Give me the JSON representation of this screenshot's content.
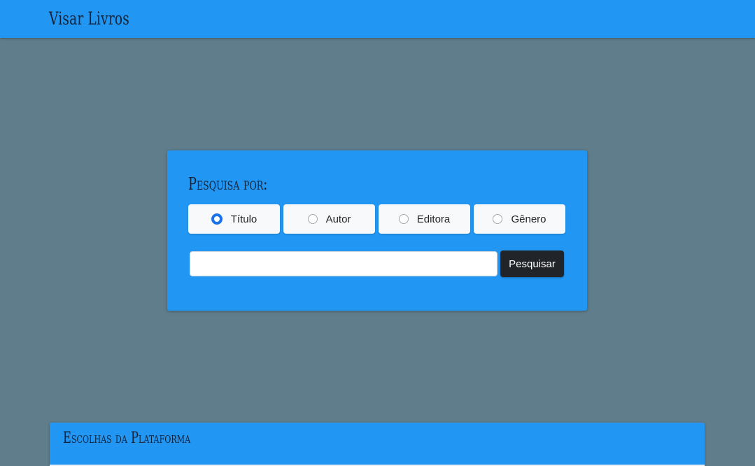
{
  "app": {
    "brand": "Visar Livros"
  },
  "search": {
    "heading": "Pesquisa por:",
    "options": [
      {
        "label": "Título",
        "checked": true
      },
      {
        "label": "Autor",
        "checked": false
      },
      {
        "label": "Editora",
        "checked": false
      },
      {
        "label": "Gênero",
        "checked": false
      }
    ],
    "input_value": "",
    "input_placeholder": "",
    "button_label": "Pesquisar"
  },
  "picks": {
    "title": "Escolhas da Plataforma"
  },
  "colors": {
    "background": "#607d8b",
    "primary": "#2196f3",
    "button_dark": "#212529",
    "radio_checked": "#1a73e8"
  }
}
